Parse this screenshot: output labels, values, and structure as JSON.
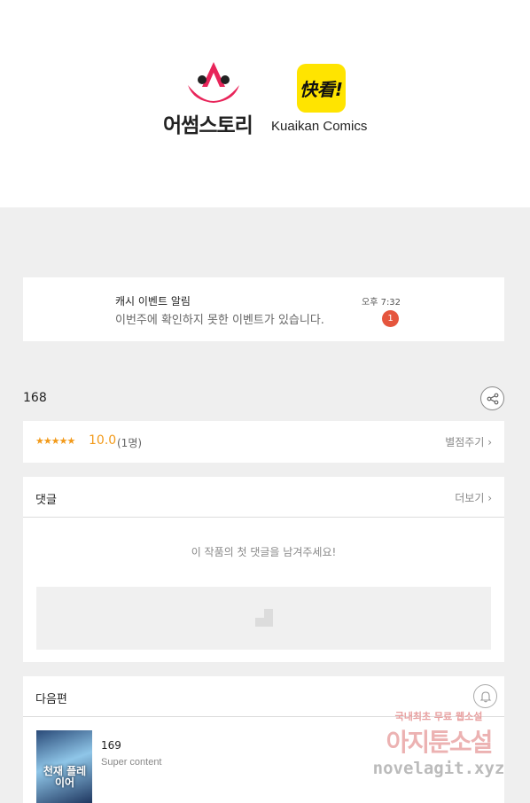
{
  "banner": {
    "logo_left_text": "어썸스토리",
    "logo_right_mark": "快看!",
    "logo_right_text": "Kuaikan Comics"
  },
  "notification": {
    "title": "캐시 이벤트 알림",
    "body": "이번주에 확인하지 못한 이벤트가 있습니다.",
    "time": "오후 7:32",
    "badge": "1"
  },
  "episode": {
    "number": "168"
  },
  "rating": {
    "stars": "★★★★★",
    "score": "10.0",
    "count": "(1명)",
    "rate_label": "별점주기 ›"
  },
  "comments": {
    "title": "댓글",
    "more_label": "더보기 ›",
    "empty_message": "이 작품의 첫 댓글을 남겨주세요!"
  },
  "next_episode": {
    "title": "다음편",
    "number": "169",
    "subtitle": "Super content",
    "thumb_title": "천재 플레이어"
  },
  "watermark": {
    "line1": "국내최초 무료 웹소설",
    "line2": "아지툰소설",
    "line3": "novelagit.xyz"
  },
  "colors": {
    "accent_orange": "#f29a1a",
    "badge_red": "#e5553d",
    "kuaikan_yellow": "#ffe400",
    "awesome_pink": "#e8255a"
  }
}
